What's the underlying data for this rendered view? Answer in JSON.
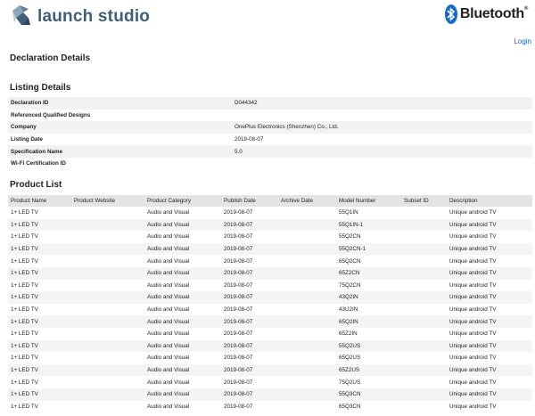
{
  "header": {
    "logo_text": "launch studio",
    "bt_text": "Bluetooth",
    "bt_reg": "®",
    "login": "Login"
  },
  "page_title": "Declaration Details",
  "listing": {
    "title": "Listing Details",
    "rows": [
      {
        "label": "Declaration ID",
        "value": "D044342"
      },
      {
        "label": "Referenced Qualified Designs",
        "value": ""
      },
      {
        "label": "Company",
        "value": "OnePlus Electronics (Shenzhen) Co., Ltd."
      },
      {
        "label": "Listing Date",
        "value": "2019-08-07"
      },
      {
        "label": "Specification Name",
        "value": "5.0"
      },
      {
        "label": "Wi-Fi Certification ID",
        "value": ""
      }
    ]
  },
  "products": {
    "title": "Product List",
    "columns": [
      "Product Name",
      "Product Website",
      "Product Category",
      "Publish Date",
      "Archive Date",
      "Model Number",
      "Subset ID",
      "Description"
    ],
    "rows": [
      [
        "1+ LED TV",
        "",
        "Audio and Visual",
        "2019-08-07",
        "",
        "55Q1IN",
        "",
        "Unique android TV"
      ],
      [
        "1+ LED TV",
        "",
        "Audio and Visual",
        "2019-08-07",
        "",
        "55Q1IN-1",
        "",
        "Unique android TV"
      ],
      [
        "1+ LED TV",
        "",
        "Audio and Visual",
        "2019-08-07",
        "",
        "55Q2CN",
        "",
        "Unique android TV"
      ],
      [
        "1+ LED TV",
        "",
        "Audio and Visual",
        "2019-08-07",
        "",
        "55Q2CN-1",
        "",
        "Unique android TV"
      ],
      [
        "1+ LED TV",
        "",
        "Audio and Visual",
        "2019-08-07",
        "",
        "65Q2CN",
        "",
        "Unique android TV"
      ],
      [
        "1+ LED TV",
        "",
        "Audio and Visual",
        "2019-08-07",
        "",
        "65Z2CN",
        "",
        "Unique android TV"
      ],
      [
        "1+ LED TV",
        "",
        "Audio and Visual",
        "2019-08-07",
        "",
        "75Q2CN",
        "",
        "Unique android TV"
      ],
      [
        "1+ LED TV",
        "",
        "Audio and Visual",
        "2019-08-07",
        "",
        "43Q2IN",
        "",
        "Unique android TV"
      ],
      [
        "1+ LED TV",
        "",
        "Audio and Visual",
        "2019-08-07",
        "",
        "43U2IN",
        "",
        "Unique android TV"
      ],
      [
        "1+ LED TV",
        "",
        "Audio and Visual",
        "2019-08-07",
        "",
        "65Q2IN",
        "",
        "Unique android TV"
      ],
      [
        "1+ LED TV",
        "",
        "Audio and Visual",
        "2019-08-07",
        "",
        "65Z2IN",
        "",
        "Unique android TV"
      ],
      [
        "1+ LED TV",
        "",
        "Audio and Visual",
        "2019-08-07",
        "",
        "55Q2US",
        "",
        "Unique android TV"
      ],
      [
        "1+ LED TV",
        "",
        "Audio and Visual",
        "2019-08-07",
        "",
        "65Q2US",
        "",
        "Unique android TV"
      ],
      [
        "1+ LED TV",
        "",
        "Audio and Visual",
        "2019-08-07",
        "",
        "65Z2US",
        "",
        "Unique android TV"
      ],
      [
        "1+ LED TV",
        "",
        "Audio and Visual",
        "2019-08-07",
        "",
        "75Q2US",
        "",
        "Unique android TV"
      ],
      [
        "1+ LED TV",
        "",
        "Audio and Visual",
        "2019-08-07",
        "",
        "55Q3CN",
        "",
        "Unique android TV"
      ],
      [
        "1+ LED TV",
        "",
        "Audio and Visual",
        "2019-08-07",
        "",
        "65Q3CN",
        "",
        "Unique android TV"
      ]
    ]
  },
  "colors": {
    "brand_text": "#3f5f78",
    "bluetooth_blue": "#1569c7",
    "link": "#1a63b8"
  }
}
